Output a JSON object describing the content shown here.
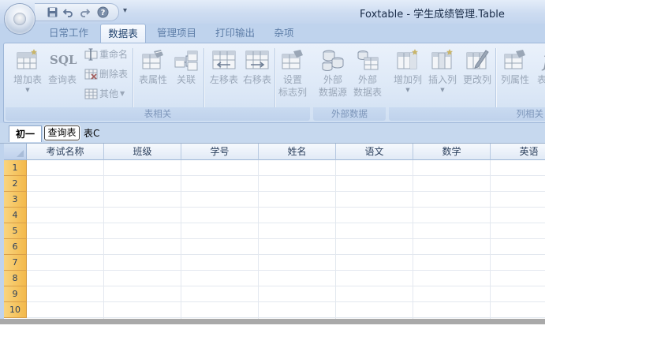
{
  "window": {
    "title": "Foxtable - 学生成绩管理.Table"
  },
  "quick_access": {
    "items": [
      "save-icon",
      "undo-icon",
      "redo-icon",
      "help-icon"
    ],
    "dropdown": "▾"
  },
  "ribbon_tabs": [
    {
      "label": "日常工作",
      "active": false
    },
    {
      "label": "数据表",
      "active": true
    },
    {
      "label": "管理项目",
      "active": false
    },
    {
      "label": "打印输出",
      "active": false
    },
    {
      "label": "杂项",
      "active": false
    }
  ],
  "ribbon": {
    "groups": {
      "table": {
        "label": "表相关",
        "add_table": "增加表",
        "query_table": "查询表",
        "sql_text": "SQL",
        "rename": "重命名",
        "delete_table": "删除表",
        "other": "其他",
        "table_props": "表属性",
        "relation": "关联",
        "move_left": "左移表",
        "move_right": "右移表",
        "set_flag_line1": "设置",
        "set_flag_line2": "标志列"
      },
      "external": {
        "label": "外部数据",
        "source_line1": "外部",
        "source_line2": "数据源",
        "table_line1": "外部",
        "table_line2": "数据表"
      },
      "column": {
        "label": "列相关",
        "add_column": "增加列",
        "insert_column": "插入列",
        "change_column": "更改列",
        "column_props": "列属性",
        "expression": "表达"
      }
    }
  },
  "sheet_tabs": [
    {
      "label": "初一",
      "state": "active"
    },
    {
      "label": "查询表",
      "state": "focused"
    },
    {
      "label": "表C",
      "state": "normal"
    }
  ],
  "grid": {
    "columns": [
      "考试名称",
      "班级",
      "学号",
      "姓名",
      "语文",
      "数学",
      "英语"
    ],
    "rows": [
      "1",
      "2",
      "3",
      "4",
      "5",
      "6",
      "7",
      "8",
      "9",
      "10"
    ]
  }
}
